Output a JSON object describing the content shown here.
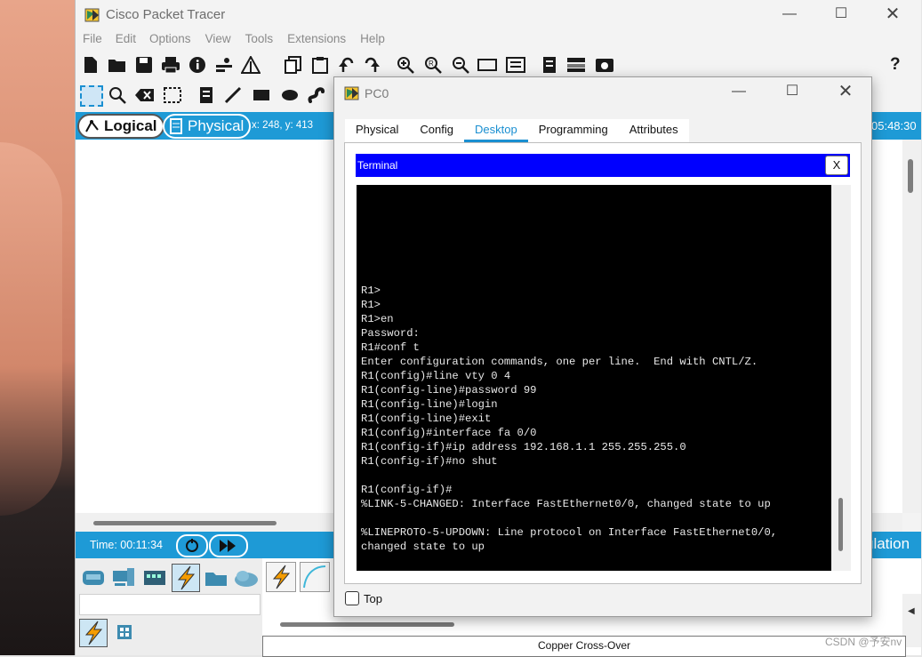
{
  "app": {
    "title": "Cisco Packet Tracer",
    "menu": [
      "File",
      "Edit",
      "Options",
      "View",
      "Tools",
      "Extensions",
      "Help"
    ],
    "help_icon": "?"
  },
  "workspace": {
    "logical_label": "Logical",
    "physical_label": "Physical",
    "coords": "x: 248, y: 413",
    "clock": "05:48:30",
    "sim_time": "Time: 00:11:34",
    "realtime_partial": "ulation",
    "cable_label": "Copper Cross-Over",
    "watermark": "CSDN @予安nv"
  },
  "pc0": {
    "title": "PC0",
    "tabs": [
      "Physical",
      "Config",
      "Desktop",
      "Programming",
      "Attributes"
    ],
    "active_tab": "Desktop",
    "terminal_title": "Terminal",
    "terminal_close": "X",
    "top_checkbox_label": "Top",
    "terminal_lines": [
      "R1>",
      "R1>",
      "R1>en",
      "Password:",
      "R1#conf t",
      "Enter configuration commands, one per line.  End with CNTL/Z.",
      "R1(config)#line vty 0 4",
      "R1(config-line)#password 99",
      "R1(config-line)#login",
      "R1(config-line)#exit",
      "R1(config)#interface fa 0/0",
      "R1(config-if)#ip address 192.168.1.1 255.255.255.0",
      "R1(config-if)#no shut",
      "",
      "R1(config-if)#",
      "%LINK-5-CHANGED: Interface FastEthernet0/0, changed state to up",
      "",
      "%LINEPROTO-5-UPDOWN: Line protocol on Interface FastEthernet0/0,",
      "changed state to up"
    ]
  },
  "colors": {
    "accent_blue": "#1e9ad6",
    "terminal_header": "#0000ff",
    "active_tab": "#1a8fd1"
  }
}
